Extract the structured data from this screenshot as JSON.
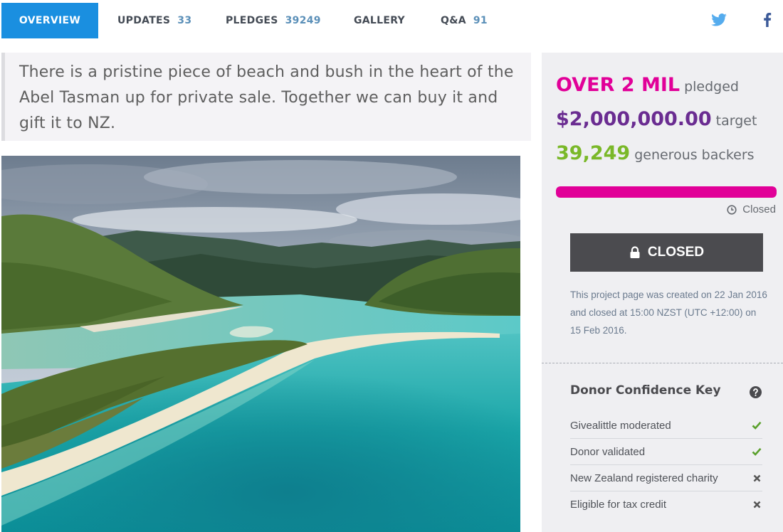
{
  "nav": {
    "tabs": [
      {
        "label": "OVERVIEW",
        "count": "",
        "active": true
      },
      {
        "label": "UPDATES",
        "count": "33"
      },
      {
        "label": "PLEDGES",
        "count": "39249"
      },
      {
        "label": "GALLERY",
        "count": ""
      },
      {
        "label": "Q&A",
        "count": "91"
      }
    ],
    "social": [
      {
        "icon": "twitter-icon",
        "color": "#55acee"
      },
      {
        "icon": "facebook-icon",
        "color": "#3b5998"
      }
    ]
  },
  "intro": {
    "text": "There is a pristine piece of beach and bush in the heart of the Abel Tasman up for private sale. Together we can buy it and gift it to NZ."
  },
  "stats": {
    "pledged_value": "OVER 2 MIL",
    "pledged_label": "pledged",
    "target_value": "$2,000,000.00",
    "target_label": "target",
    "backers_value": "39,249",
    "backers_label": "generous backers",
    "progress_fraction": 1.0
  },
  "status": {
    "icon": "clock-icon",
    "text": "Closed"
  },
  "button": {
    "icon": "lock-icon",
    "label": "CLOSED"
  },
  "created_text": "This project page was created on 22 Jan 2016 and closed at 15:00 NZST (UTC +12:00) on 15 Feb 2016.",
  "donor_key": {
    "title": "Donor Confidence Key",
    "help_icon": "question-circle-icon",
    "items": [
      {
        "label": "Givealittle moderated",
        "status": "check"
      },
      {
        "label": "Donor validated",
        "status": "check"
      },
      {
        "label": "New Zealand registered charity",
        "status": "cross"
      },
      {
        "label": "Eligible for tax credit",
        "status": "cross"
      }
    ]
  },
  "colors": {
    "accent_blue": "#1a8fe0",
    "pledged_magenta": "#e10098",
    "target_purple": "#6a2c91",
    "backers_green": "#7ab829",
    "check_green": "#5aa02c",
    "cross_dark": "#555555"
  }
}
